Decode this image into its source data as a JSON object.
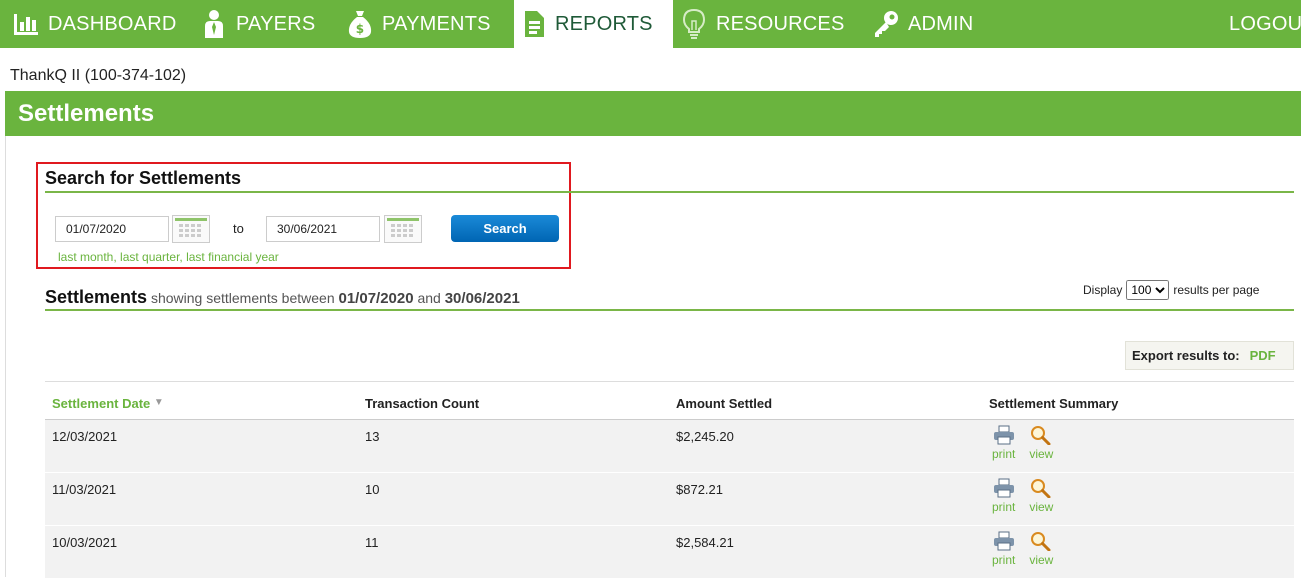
{
  "nav": {
    "items": [
      {
        "label": "DASHBOARD",
        "icon": "bar-chart-icon"
      },
      {
        "label": "PAYERS",
        "icon": "person-icon"
      },
      {
        "label": "PAYMENTS",
        "icon": "money-bag-icon"
      },
      {
        "label": "REPORTS",
        "icon": "document-icon",
        "active": true
      },
      {
        "label": "RESOURCES",
        "icon": "lightbulb-icon"
      },
      {
        "label": "ADMIN",
        "icon": "key-icon"
      }
    ],
    "logout": "LOGOUT"
  },
  "account": "ThankQ II (100-374-102)",
  "page_title": "Settlements",
  "search": {
    "title": "Search for Settlements",
    "from_date": "01/07/2020",
    "to_label": "to",
    "to_date": "30/06/2021",
    "button": "Search",
    "quick_links": [
      "last month",
      "last quarter",
      "last financial year"
    ]
  },
  "results": {
    "heading": "Settlements",
    "showing": "showing settlements between",
    "from": "01/07/2020",
    "and": "and",
    "to": "30/06/2021",
    "display_label": "Display",
    "per_page": "100",
    "per_page_label": "results per page",
    "export_label": "Export results to:",
    "export_pdf": "PDF"
  },
  "table": {
    "columns": [
      "Settlement Date",
      "Transaction Count",
      "Amount Settled",
      "Settlement Summary"
    ],
    "rows": [
      {
        "date": "12/03/2021",
        "count": "13",
        "amount": "$2,245.20"
      },
      {
        "date": "11/03/2021",
        "count": "10",
        "amount": "$872.21"
      },
      {
        "date": "10/03/2021",
        "count": "11",
        "amount": "$2,584.21"
      }
    ],
    "print_label": "print",
    "view_label": "view"
  },
  "colors": {
    "brand_green": "#6ab43e",
    "highlight_red": "#e0191f",
    "button_blue": "#0a78c8"
  }
}
